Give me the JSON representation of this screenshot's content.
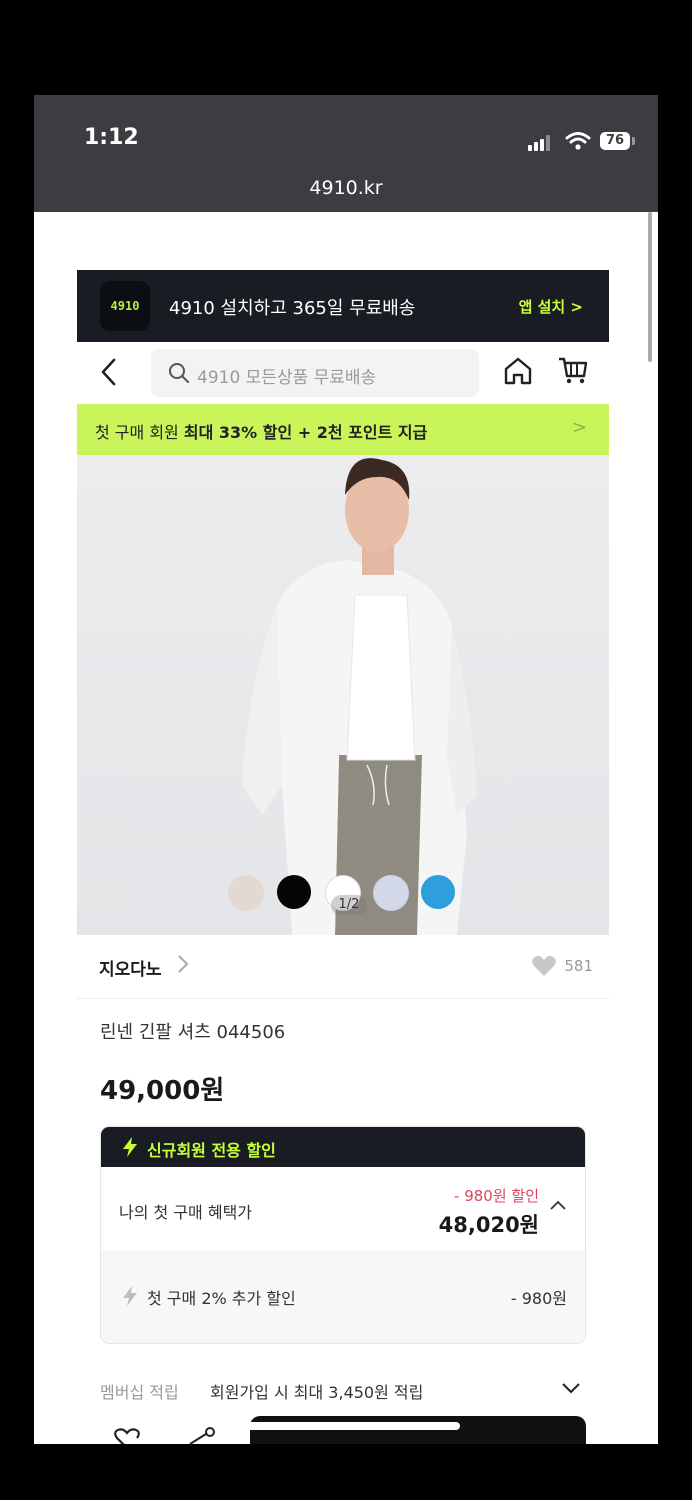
{
  "status_bar": {
    "time": "1:12",
    "battery": "76",
    "url": "4910.kr"
  },
  "app_banner": {
    "logo_text": "4910",
    "text": "4910 설치하고 365일 무료배송",
    "install": "앱 설치 >"
  },
  "nav": {
    "search_placeholder": "4910 모든상품 무료배송"
  },
  "promo": {
    "text_normal": "첫 구매 회원 ",
    "text_bold": "최대 33% 할인 + 2천 포인트 지급",
    "chevron": ">"
  },
  "gallery": {
    "pager": "1/2",
    "swatches": [
      "#e4d8d3",
      "#050505",
      "#ffffff",
      "#d2d8e8",
      "#2f9fdc"
    ]
  },
  "product": {
    "brand": "지오다노",
    "like_count": "581",
    "name": "린넨 긴팔 셔츠 044506",
    "price": "49,000원"
  },
  "discount": {
    "header": "신규회원 전용 할인",
    "mine_label": "나의 첫 구매 혜택가",
    "mine_discount": "- 980원 할인",
    "mine_price": "48,020원",
    "extra_label": "첫 구매 2% 추가 할인",
    "extra_value": "- 980원"
  },
  "membership": {
    "label": "멤버십 적립",
    "text": "회원가입 시 최대 3,450원 적립"
  },
  "colors": {
    "accent_green": "#c9f55b",
    "dark": "#1a1c24",
    "sale_red": "#e0435e"
  }
}
